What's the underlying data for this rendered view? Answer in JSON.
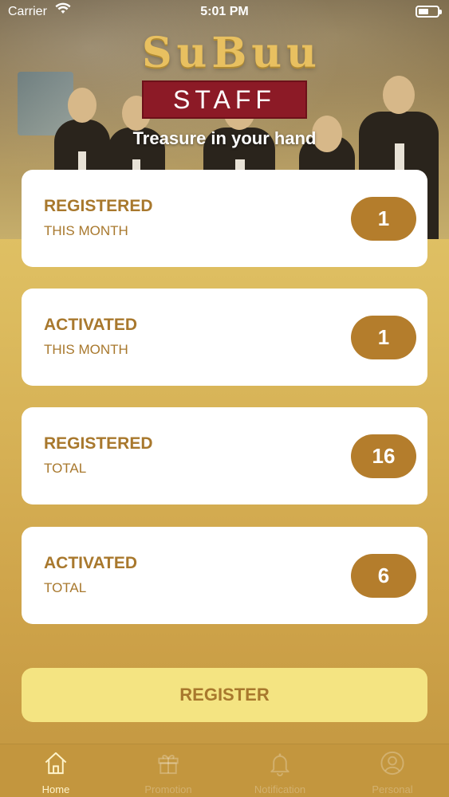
{
  "status_bar": {
    "carrier": "Carrier",
    "time": "5:01 PM"
  },
  "hero": {
    "logo_text": "SuBuu",
    "badge": "STAFF",
    "tagline": "Treasure in your hand"
  },
  "stats": [
    {
      "title": "REGISTERED",
      "period": "THIS MONTH",
      "count": "1"
    },
    {
      "title": "ACTIVATED",
      "period": "THIS MONTH",
      "count": "1"
    },
    {
      "title": "REGISTERED",
      "period": "TOTAL",
      "count": "16"
    },
    {
      "title": "ACTIVATED",
      "period": "TOTAL",
      "count": "6"
    }
  ],
  "register_button": "REGISTER",
  "tabs": [
    {
      "label": "Home",
      "icon": "home-icon",
      "active": true
    },
    {
      "label": "Promotion",
      "icon": "gift-icon",
      "active": false
    },
    {
      "label": "Notification",
      "icon": "bell-icon",
      "active": false
    },
    {
      "label": "Personal",
      "icon": "profile-icon",
      "active": false
    }
  ],
  "colors": {
    "accent": "#b47d2c",
    "label": "#a8782d",
    "button": "#f4e482",
    "badge_bg": "#8c1a26"
  }
}
